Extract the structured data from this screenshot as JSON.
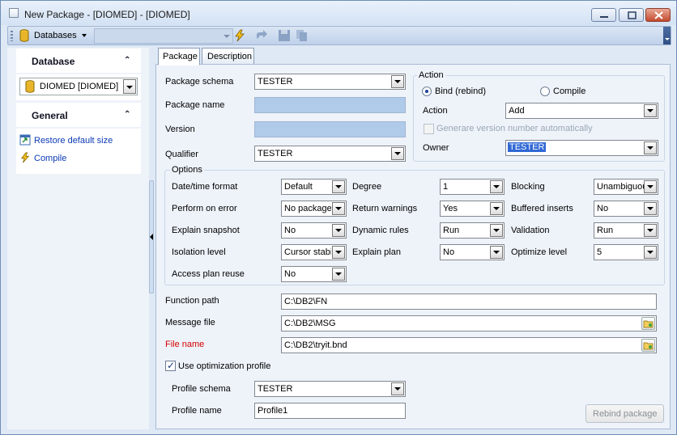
{
  "window": {
    "title": "New Package - [DIOMED] - [DIOMED]"
  },
  "toolbar": {
    "databases_label": "Databases",
    "combo_value": ""
  },
  "sidebar": {
    "database_header": "Database",
    "database_value": "DIOMED [DIOMED]",
    "general_header": "General",
    "links": [
      "Restore default size",
      "Compile"
    ]
  },
  "tabs": [
    "Package",
    "Description"
  ],
  "package": {
    "schema_label": "Package schema",
    "schema_value": "TESTER",
    "name_label": "Package name",
    "name_value": "",
    "version_label": "Version",
    "version_value": "",
    "qualifier_label": "Qualifier",
    "qualifier_value": "TESTER"
  },
  "action": {
    "group_title": "Action",
    "bind_label": "Bind (rebind)",
    "compile_label": "Compile",
    "action_label": "Action",
    "action_value": "Add",
    "generate_label": "Generare version number automatically",
    "owner_label": "Owner",
    "owner_value": "TESTER"
  },
  "options": {
    "group_title": "Options",
    "items": [
      {
        "label": "Date/time format",
        "value": "Default"
      },
      {
        "label": "Degree",
        "value": "1"
      },
      {
        "label": "Blocking",
        "value": "Unambiguous"
      },
      {
        "label": "Perform on error",
        "value": "No package"
      },
      {
        "label": "Return warnings",
        "value": "Yes"
      },
      {
        "label": "Buffered inserts",
        "value": "No"
      },
      {
        "label": "Explain snapshot",
        "value": "No"
      },
      {
        "label": "Dynamic rules",
        "value": "Run"
      },
      {
        "label": "Validation",
        "value": "Run"
      },
      {
        "label": "Isolation level",
        "value": "Cursor stability"
      },
      {
        "label": "Explain plan",
        "value": "No"
      },
      {
        "label": "Optimize level",
        "value": "5"
      },
      {
        "label": "Access plan reuse",
        "value": "No"
      }
    ]
  },
  "paths": {
    "function_label": "Function path",
    "function_value": "C:\\DB2\\FN",
    "message_label": "Message file",
    "message_value": "C:\\DB2\\MSG",
    "file_label": "File name",
    "file_value": "C:\\DB2\\tryit.bnd"
  },
  "optimization": {
    "use_label": "Use optimization profile",
    "profile_schema_label": "Profile schema",
    "profile_schema_value": "TESTER",
    "profile_name_label": "Profile name",
    "profile_name_value": "Profile1"
  },
  "buttons": {
    "rebind": "Rebind package"
  },
  "colors": {
    "accent_blue": "#b0cbe9",
    "link_blue": "#0c3ab6",
    "required_red": "#d40000"
  }
}
